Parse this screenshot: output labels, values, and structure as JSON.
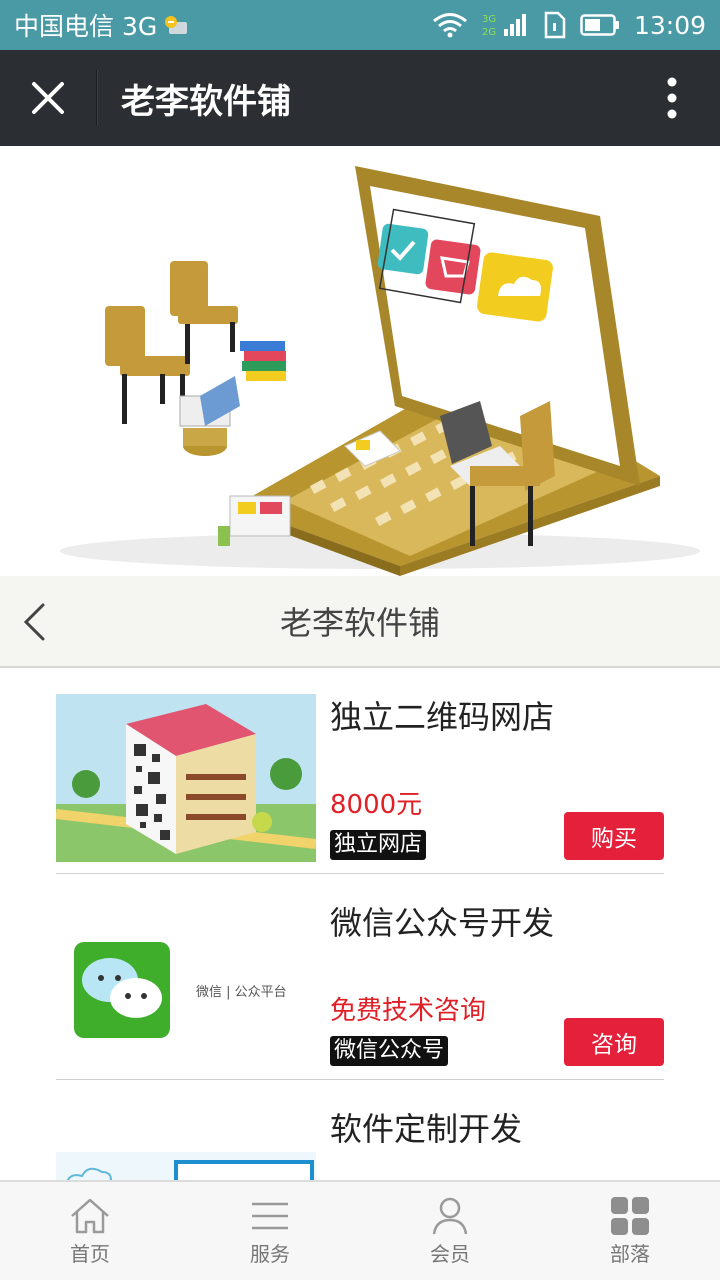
{
  "status_bar": {
    "carrier": "中国电信 3G",
    "time": "13:09",
    "network_badge_top": "3G",
    "network_badge_bottom": "2G"
  },
  "title_bar": {
    "title": "老李软件铺"
  },
  "sub_header": {
    "title": "老李软件铺"
  },
  "products": [
    {
      "name": "独立二维码网店",
      "price": "8000元",
      "tag": "独立网店",
      "button": "购买"
    },
    {
      "name": "微信公众号开发",
      "price": "免费技术咨询",
      "tag": "微信公众号",
      "button": "咨询",
      "thumb_text": "微信 | 公众平台"
    },
    {
      "name": "软件定制开发"
    }
  ],
  "bottom_nav": [
    {
      "label": "首页",
      "icon": "home-icon"
    },
    {
      "label": "服务",
      "icon": "list-icon"
    },
    {
      "label": "会员",
      "icon": "user-icon"
    },
    {
      "label": "部落",
      "icon": "grid-icon"
    }
  ],
  "colors": {
    "status_bar": "#4a9aa6",
    "title_bar": "#2b2f33",
    "accent_red": "#e5203a",
    "price_red": "#e01f26"
  }
}
